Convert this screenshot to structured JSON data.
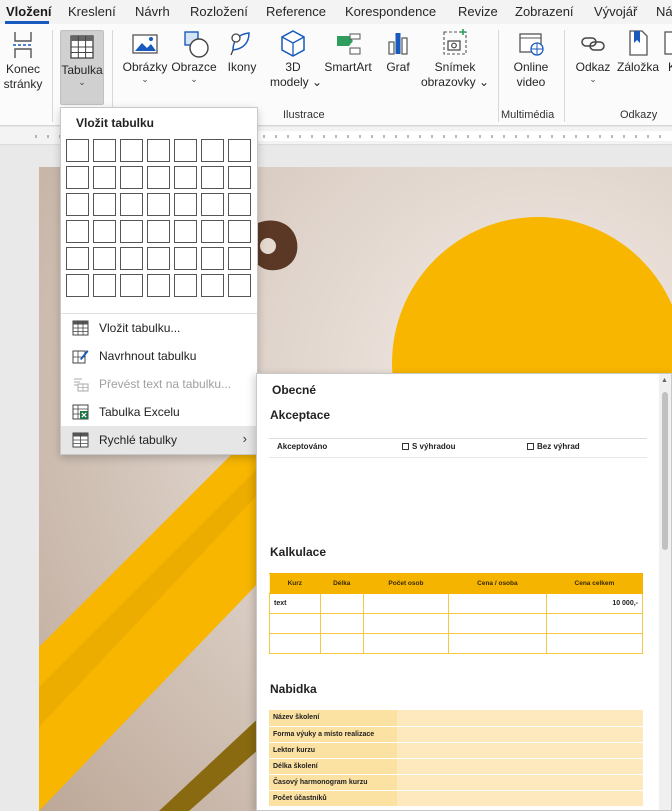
{
  "tabs": [
    "Vložení",
    "Kreslení",
    "Návrh",
    "Rozložení",
    "Reference",
    "Korespondence",
    "Revize",
    "Zobrazení",
    "Vývojář",
    "Ná"
  ],
  "ribbon": {
    "konec": {
      "line1": "Konec",
      "line2": "stránky"
    },
    "tabulka": "Tabulka",
    "obrazky": "Obrázky",
    "obrazce": "Obrazce",
    "ikony": "Ikony",
    "modely": {
      "line1": "3D",
      "line2": "modely"
    },
    "smartart": "SmartArt",
    "graf": "Graf",
    "snimek": {
      "line1": "Snímek",
      "line2": "obrazovky"
    },
    "online": {
      "line1": "Online",
      "line2": "video"
    },
    "odkaz": "Odkaz",
    "zalozka": "Záložka",
    "kr": "K",
    "groups": {
      "ilustrace": "Ilustrace",
      "multimedia": "Multimédia",
      "odkazy": "Odkazy"
    }
  },
  "dropdown": {
    "title": "Vložit tabulku",
    "items": [
      {
        "label": "Vložit tabulku...",
        "icon": "table-icon",
        "disabled": false
      },
      {
        "label": "Navrhnout tabulku",
        "icon": "pencil-table-icon",
        "disabled": false
      },
      {
        "label": "Převést text na tabulku...",
        "icon": "convert-text-icon",
        "disabled": true
      },
      {
        "label": "Tabulka Excelu",
        "icon": "excel-table-icon",
        "disabled": false
      },
      {
        "label": "Rychlé tabulky",
        "icon": "quick-tables-icon",
        "disabled": false,
        "submenu": true
      }
    ]
  },
  "gallery": {
    "header": "Obecné",
    "akceptace": {
      "title": "Akceptace",
      "col1": "Akceptováno",
      "col2": "S výhradou",
      "col3": "Bez výhrad"
    },
    "kalkulace": {
      "title": "Kalkulace",
      "headers": [
        "Kurz",
        "Délka",
        "Počet osob",
        "Cena / osoba",
        "Cena celkem"
      ],
      "rows": [
        [
          "text",
          "",
          "",
          "",
          "10 000,-"
        ],
        [
          "",
          "",
          "",
          "",
          ""
        ],
        [
          "",
          "",
          "",
          "",
          ""
        ]
      ]
    },
    "nabidka": {
      "title": "Nabidka",
      "rows": [
        "Název školení",
        "Forma výuky a místo realizace",
        "Lektor kurzu",
        "Délka školení",
        "Časový harmonogram kurzu",
        "Počet účastníků"
      ]
    }
  },
  "colors": {
    "accent": "#185abd",
    "yellow": "#f8b600",
    "brown": "#5a3825",
    "table_header": "#f4b400"
  }
}
